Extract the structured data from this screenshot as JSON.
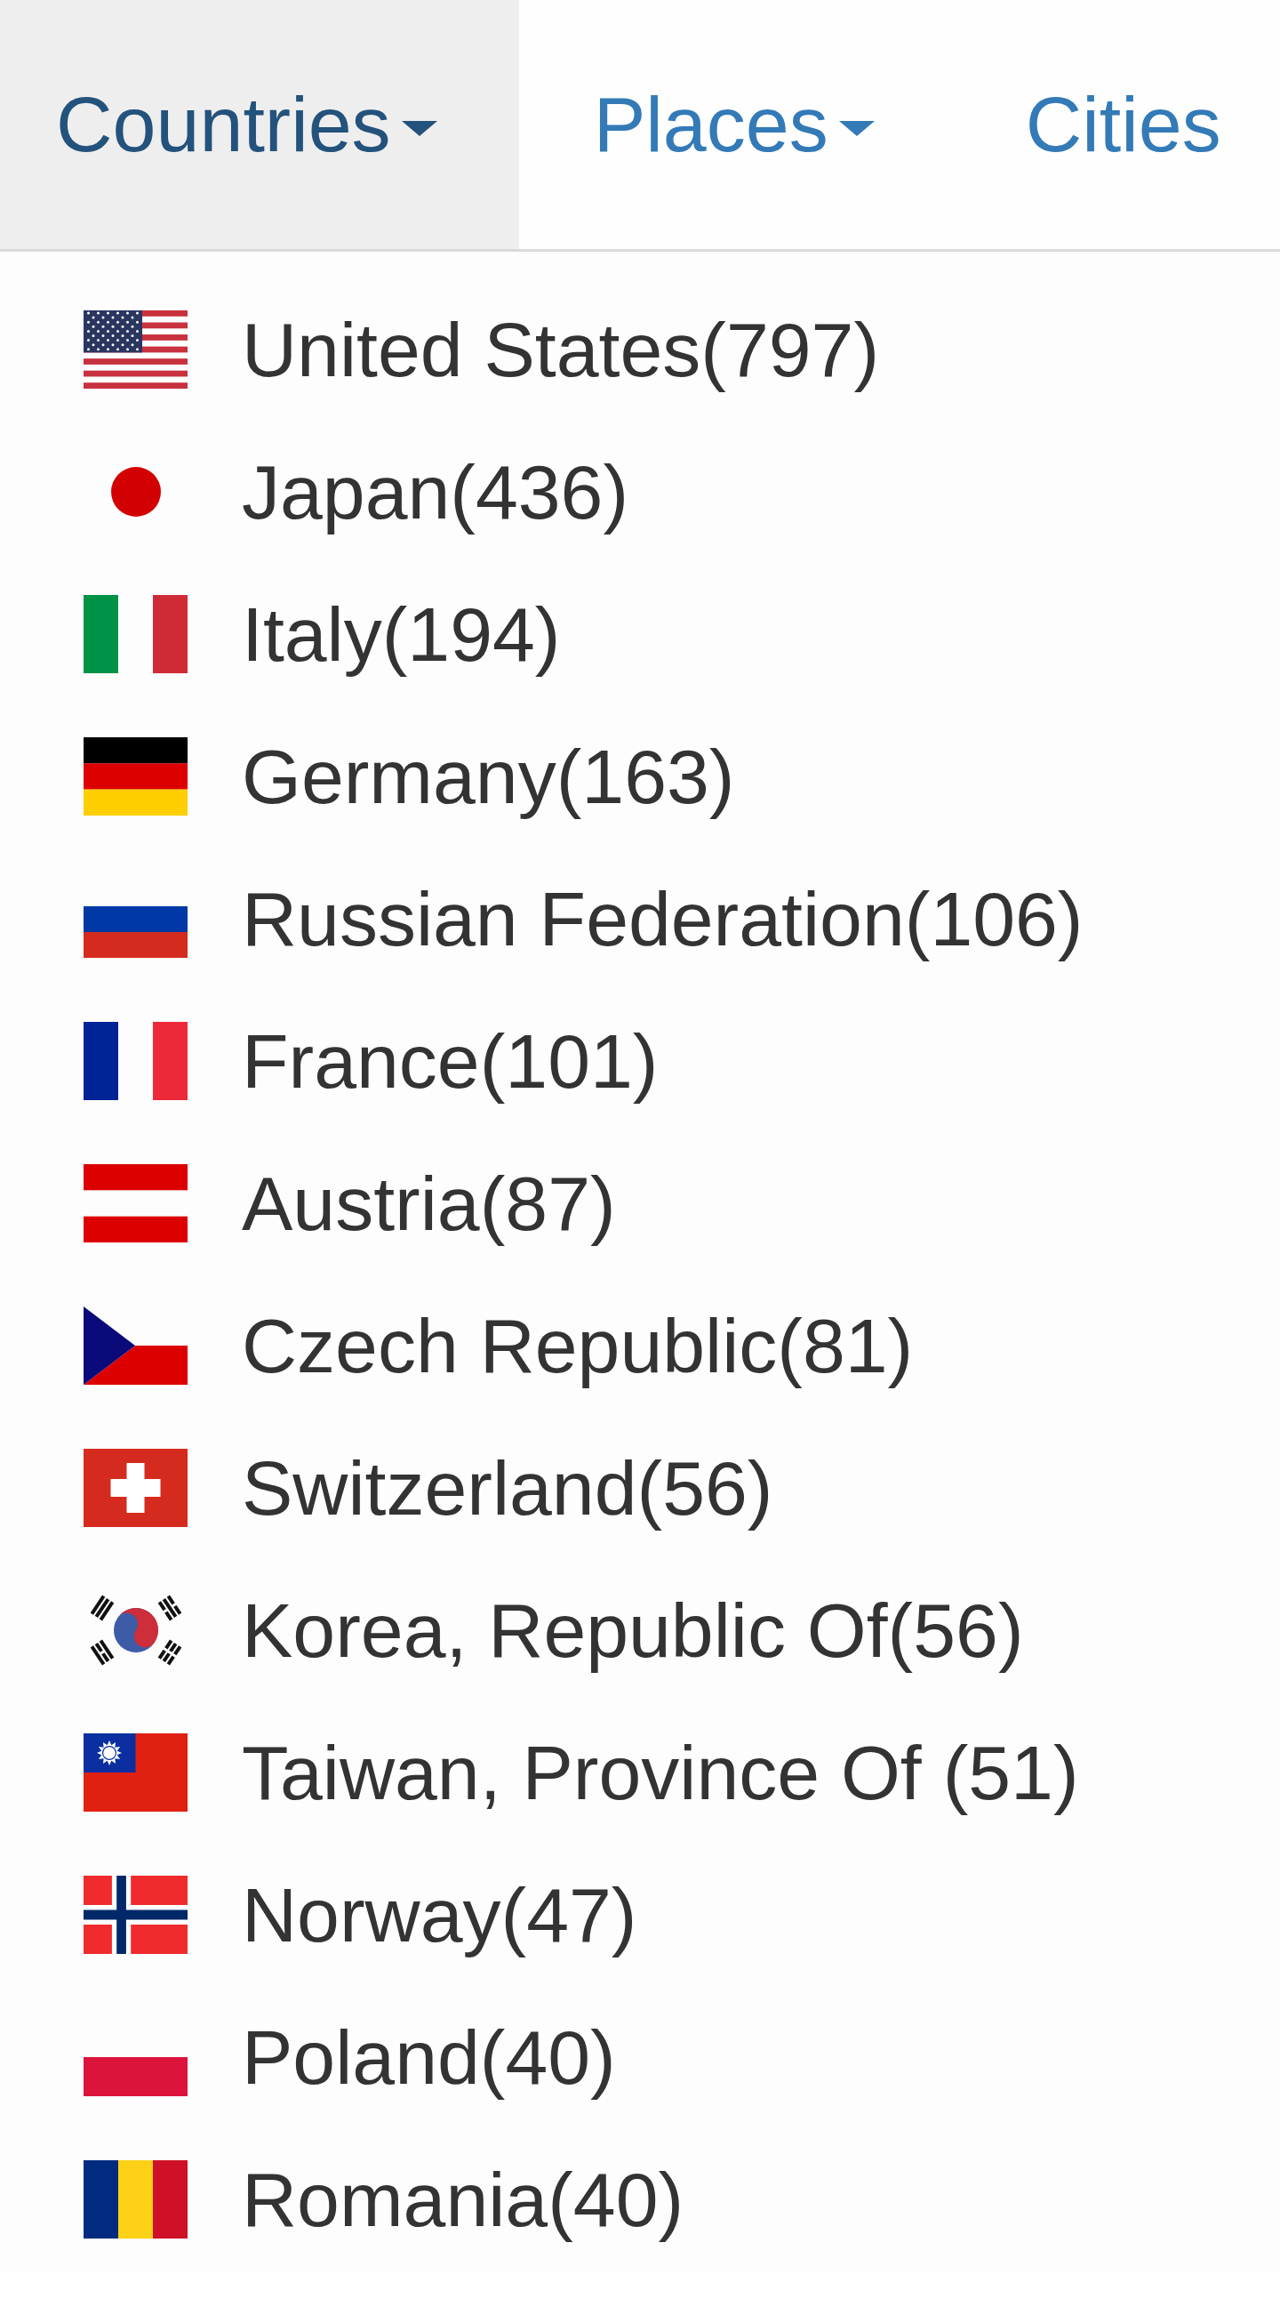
{
  "nav": {
    "tabs": [
      {
        "label": "Countries",
        "kind": "dropdown",
        "selected": true
      },
      {
        "label": "Places",
        "kind": "dropdown",
        "selected": false
      },
      {
        "label": "Cities",
        "kind": "link",
        "selected": false
      }
    ]
  },
  "dropdown_menu": {
    "items": [
      {
        "label": "United States(797)",
        "kind": "usa"
      },
      {
        "label": "Japan(436)",
        "kind": "japan"
      },
      {
        "label": "Italy(194)",
        "kind": "italy"
      },
      {
        "label": "Germany(163)",
        "kind": "germany"
      },
      {
        "label": "Russian Federation(106)",
        "kind": "russia"
      },
      {
        "label": "France(101)",
        "kind": "france"
      },
      {
        "label": "Austria(87)",
        "kind": "austria"
      },
      {
        "label": "Czech Republic(81)",
        "kind": "czech"
      },
      {
        "label": "Switzerland(56)",
        "kind": "switzerland"
      },
      {
        "label": "Korea, Republic Of(56)",
        "kind": "korea"
      },
      {
        "label": "Taiwan, Province Of (51)",
        "kind": "taiwan"
      },
      {
        "label": "Norway(47)",
        "kind": "norway"
      },
      {
        "label": "Poland(40)",
        "kind": "poland"
      },
      {
        "label": "Romania(40)",
        "kind": "romania"
      }
    ]
  }
}
